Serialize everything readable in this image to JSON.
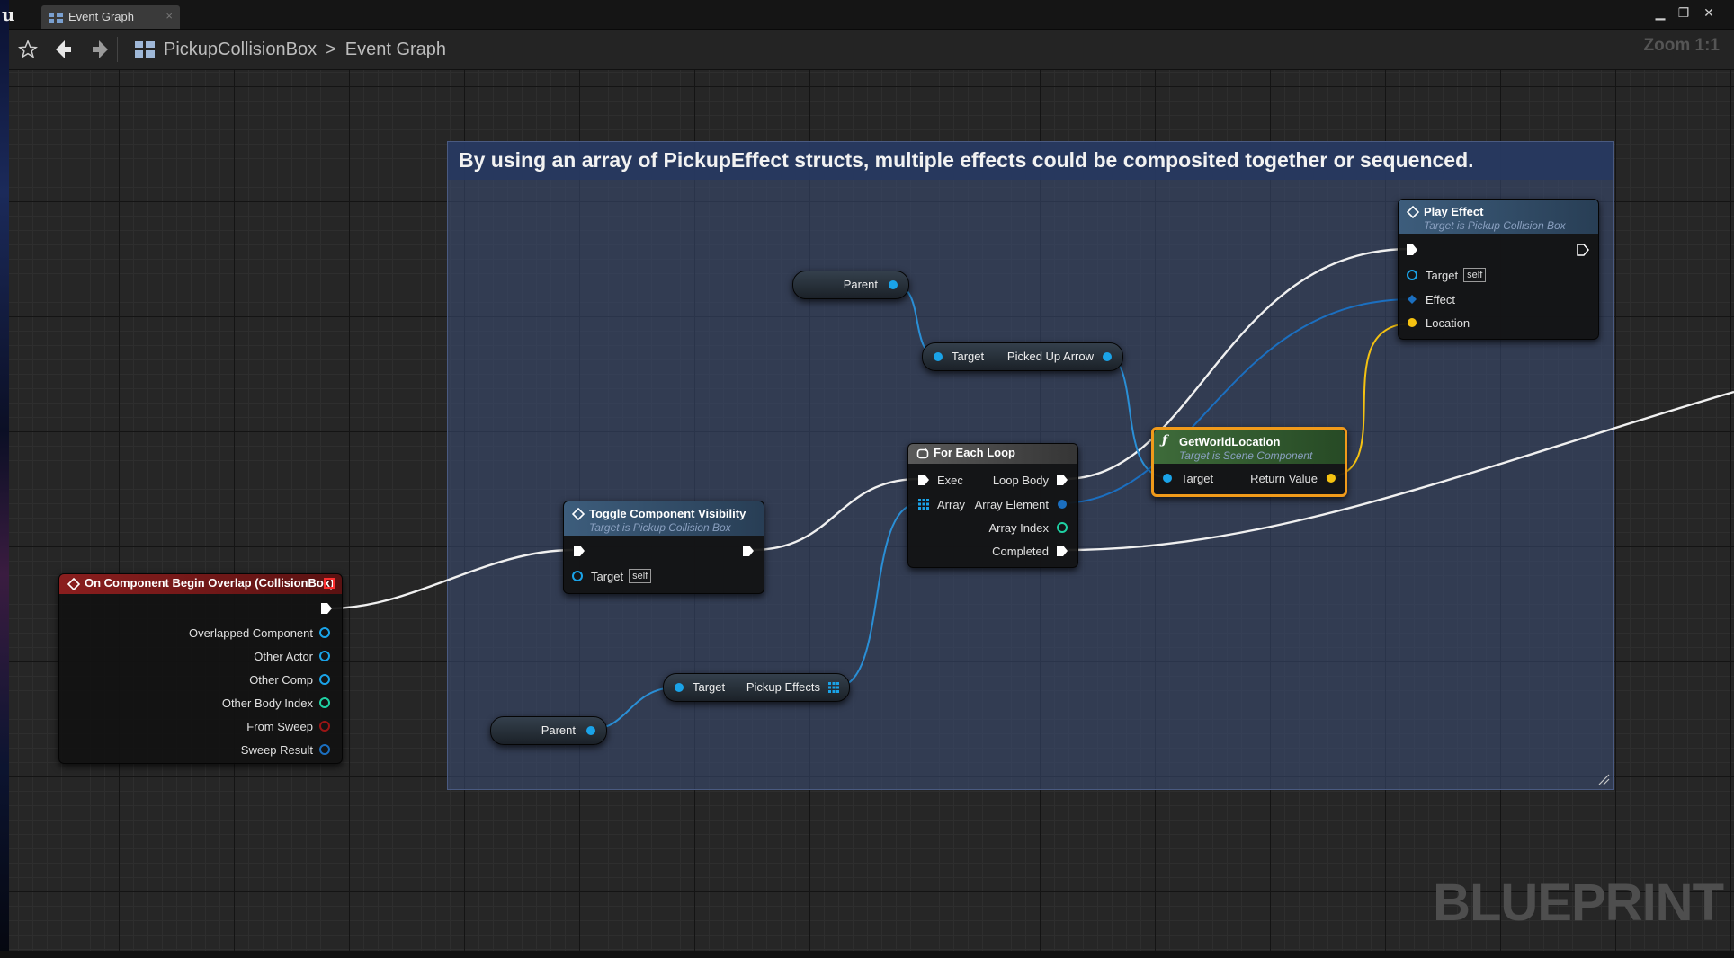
{
  "window": {
    "tab_label": "Event Graph",
    "tab_close": "×",
    "minimize": "▁",
    "restore": "❐",
    "close": "✕"
  },
  "toolbar": {
    "breadcrumb": [
      "PickupCollisionBox",
      "Event Graph"
    ],
    "breadcrumb_separator": ">",
    "zoom": "Zoom 1:1"
  },
  "comment": {
    "text": "By using an array of PickupEffect structs, multiple effects could be composited together or sequenced."
  },
  "nodes": {
    "on_overlap": {
      "title": "On Component Begin Overlap (CollisionBox)",
      "pins": [
        "Overlapped Component",
        "Other Actor",
        "Other Comp",
        "Other Body Index",
        "From Sweep",
        "Sweep Result"
      ]
    },
    "toggle_visibility": {
      "title": "Toggle Component Visibility",
      "subtitle": "Target is Pickup Collision Box",
      "target_label": "Target",
      "self_label": "self"
    },
    "for_each": {
      "title": "For Each Loop",
      "inputs": [
        "Exec",
        "Array"
      ],
      "outputs": [
        "Loop Body",
        "Array Element",
        "Array Index",
        "Completed"
      ]
    },
    "get_world_location": {
      "title": "GetWorldLocation",
      "subtitle": "Target is Scene Component",
      "input": "Target",
      "output": "Return Value"
    },
    "play_effect": {
      "title": "Play Effect",
      "subtitle": "Target is Pickup Collision Box",
      "inputs": [
        "Target",
        "Effect",
        "Location"
      ],
      "self_label": "self"
    },
    "parent_top": {
      "label": "Parent"
    },
    "picked_up_arrow": {
      "input": "Target",
      "output": "Picked Up Arrow"
    },
    "parent_bottom": {
      "label": "Parent"
    },
    "pickup_effects": {
      "input": "Target",
      "output": "Pickup Effects"
    }
  },
  "colors": {
    "exec": "#ffffff",
    "object": "#1aa3e8",
    "vector": "#f5c211",
    "int": "#1fd1a3",
    "bool": "#8c1414",
    "event_header": "#8a1e1e",
    "function_header": "#3e6b3a",
    "target_header": "#3d5d7c",
    "selected_outline": "#f09a1a"
  },
  "watermark": "BLUEPRINT"
}
